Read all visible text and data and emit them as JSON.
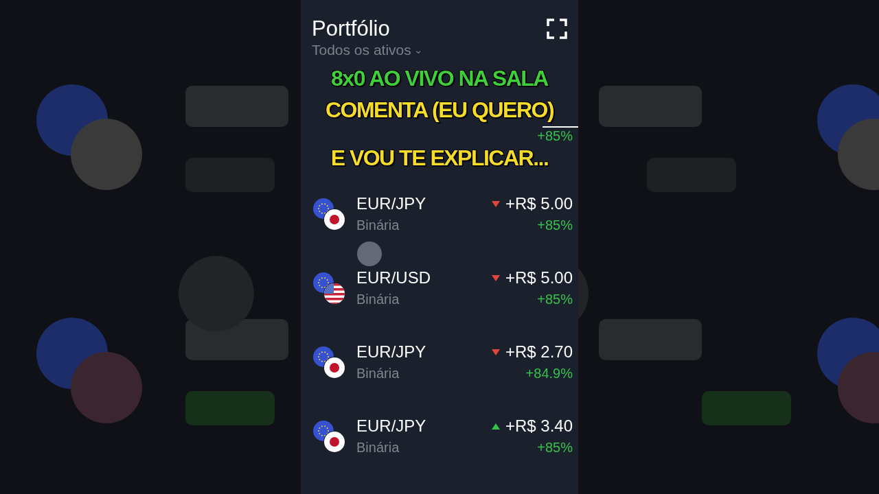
{
  "header": {
    "title": "Portfólio",
    "filter": "Todos os ativos",
    "filter_caret": "⌄"
  },
  "trades": [
    {
      "payout": "+85%",
      "touched": false
    },
    {
      "asset": "EUR/JPY",
      "type": "Binária",
      "amount": "+R$ 5.00",
      "payout": "+85%",
      "rising": false,
      "kind": "jp",
      "touched": false
    },
    {
      "asset": "EUR/USD",
      "type": "Binária",
      "amount": "+R$ 5.00",
      "payout": "+85%",
      "rising": false,
      "kind": "us",
      "touched": true
    },
    {
      "asset": "EUR/JPY",
      "type": "Binária",
      "amount": "+R$ 2.70",
      "payout": "+84.9%",
      "rising": false,
      "kind": "jp",
      "touched": false
    },
    {
      "asset": "EUR/JPY",
      "type": "Binária",
      "amount": "+R$ 3.40",
      "payout": "+85%",
      "rising": true,
      "kind": "jp",
      "touched": false
    }
  ],
  "caption": [
    {
      "text": "8x0 AO VIVO NA SALA",
      "color": "#3fcf3a"
    },
    {
      "text": "COMENTA (EU QUERO)",
      "color": "#f5dc2a"
    },
    {
      "text": "E VOU TE EXPLICAR...",
      "color": "#f5dc2a"
    }
  ]
}
